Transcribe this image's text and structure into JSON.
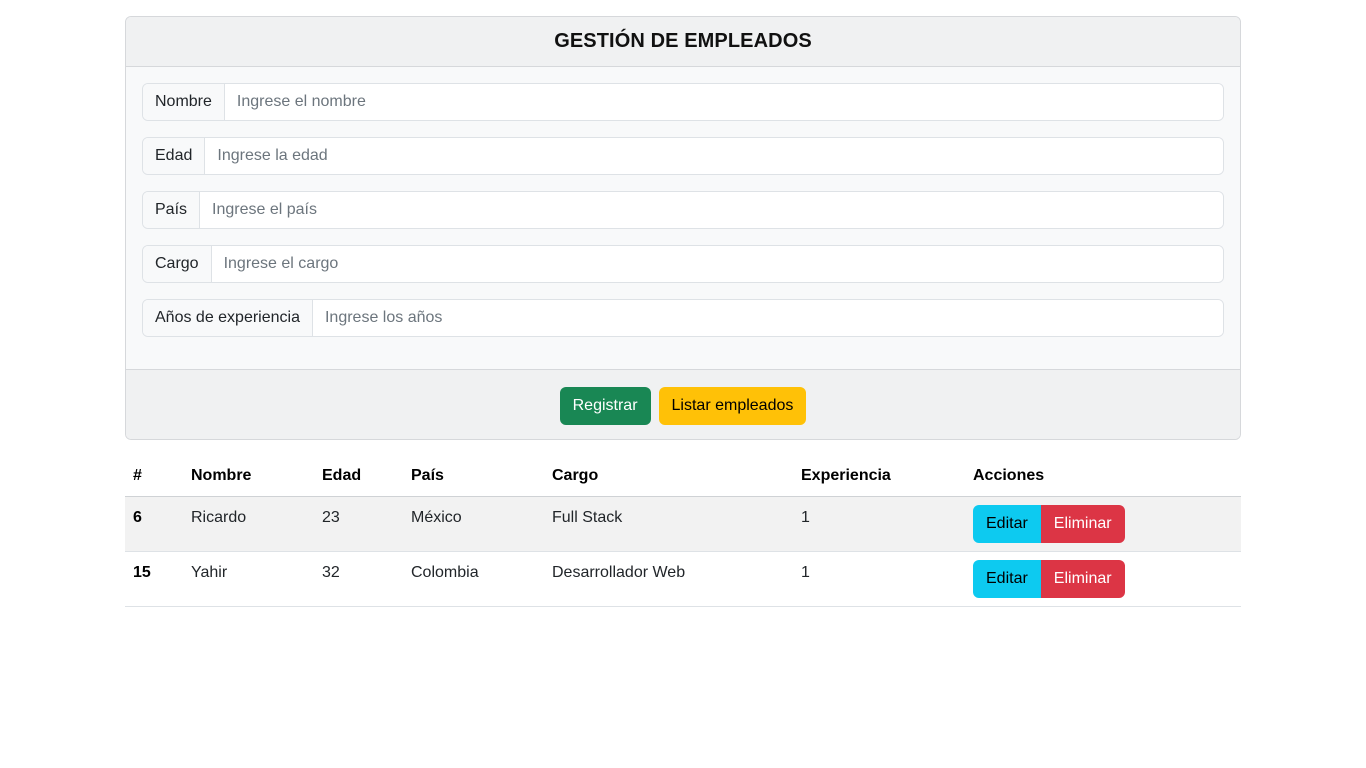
{
  "form": {
    "title": "GESTIÓN DE EMPLEADOS",
    "fields": [
      {
        "label": "Nombre",
        "placeholder": "Ingrese el nombre"
      },
      {
        "label": "Edad",
        "placeholder": "Ingrese la edad"
      },
      {
        "label": "País",
        "placeholder": "Ingrese el país"
      },
      {
        "label": "Cargo",
        "placeholder": "Ingrese el cargo"
      },
      {
        "label": "Años de experiencia",
        "placeholder": "Ingrese los años"
      }
    ],
    "register_label": "Registrar",
    "list_label": "Listar empleados"
  },
  "table": {
    "headers": [
      "#",
      "Nombre",
      "Edad",
      "País",
      "Cargo",
      "Experiencia",
      "Acciones"
    ],
    "rows": [
      {
        "id": "6",
        "nombre": "Ricardo",
        "edad": "23",
        "pais": "México",
        "cargo": "Full Stack",
        "experiencia": "1"
      },
      {
        "id": "15",
        "nombre": "Yahir",
        "edad": "32",
        "pais": "Colombia",
        "cargo": "Desarrollador Web",
        "experiencia": "1"
      }
    ],
    "edit_label": "Editar",
    "delete_label": "Eliminar"
  },
  "colors": {
    "success": "#198754",
    "warning": "#ffc107",
    "info": "#0dcaf0",
    "danger": "#dc3545"
  }
}
